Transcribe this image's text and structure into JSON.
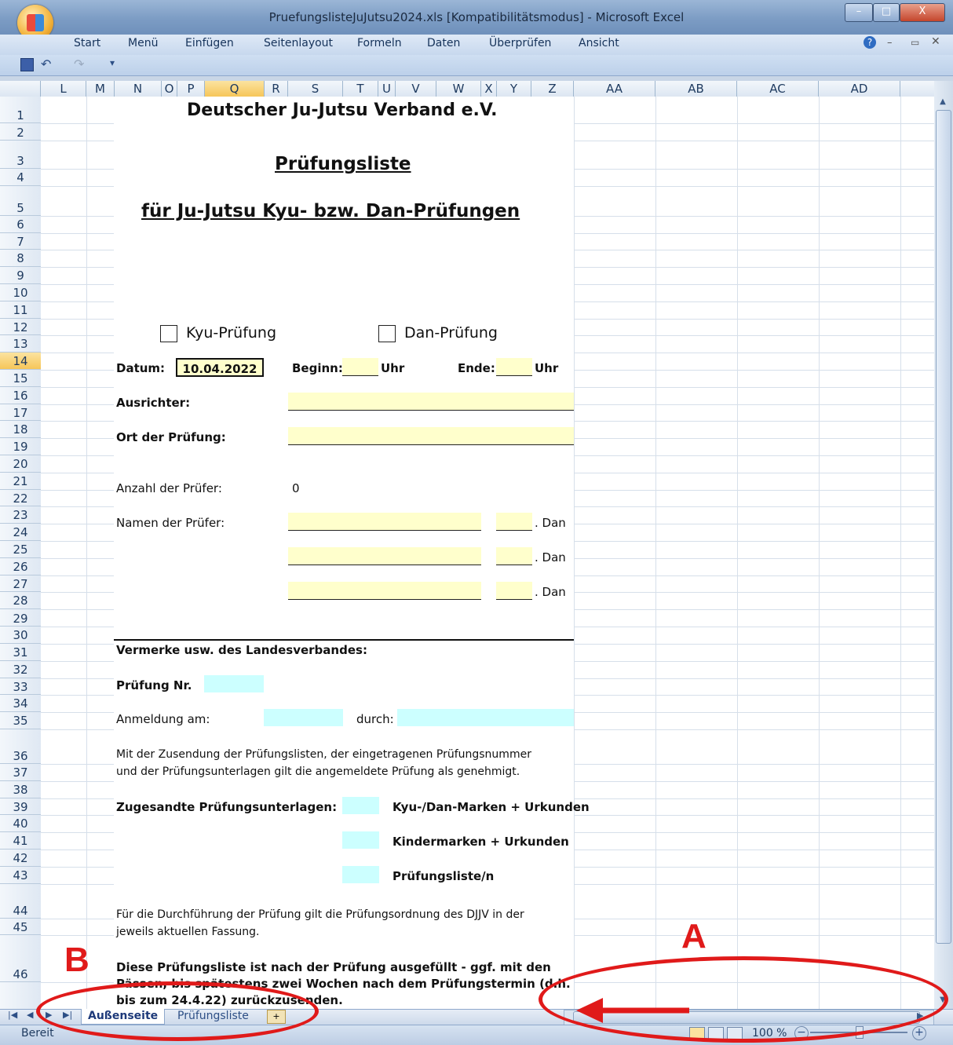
{
  "window": {
    "title": "PruefungslisteJuJutsu2024.xls [Kompatibilitätsmodus] - Microsoft Excel",
    "minimize": "–",
    "maximize": "□",
    "close": "X"
  },
  "ribbon_tabs": [
    "Start",
    "Menü",
    "Einfügen",
    "Seitenlayout",
    "Formeln",
    "Daten",
    "Überprüfen",
    "Ansicht"
  ],
  "quick_access": {
    "save": "save-icon",
    "undo": "undo-icon",
    "redo": "redo-icon",
    "more": "▾"
  },
  "columns": [
    "L",
    "M",
    "N",
    "O",
    "P",
    "Q",
    "R",
    "S",
    "T",
    "U",
    "V",
    "W",
    "X",
    "Y",
    "Z",
    "AA",
    "AB",
    "AC",
    "AD"
  ],
  "selected_column": "Q",
  "rows": [
    "1",
    "2",
    "3",
    "4",
    "5",
    "6",
    "7",
    "8",
    "9",
    "10",
    "11",
    "12",
    "13",
    "14",
    "15",
    "16",
    "17",
    "18",
    "19",
    "20",
    "21",
    "22",
    "23",
    "24",
    "25",
    "26",
    "27",
    "28",
    "29",
    "30",
    "31",
    "32",
    "33",
    "34",
    "35",
    "36",
    "37",
    "38",
    "39",
    "40",
    "41",
    "42",
    "43",
    "44",
    "45",
    "46"
  ],
  "selected_row": "14",
  "sheet": {
    "org": "Deutscher Ju-Jutsu Verband e.V.",
    "heading": "Prüfungsliste",
    "subheading": "für Ju-Jutsu Kyu- bzw. Dan-Prüfungen",
    "kyu_label": "Kyu-Prüfung",
    "dan_label": "Dan-Prüfung",
    "datum_label": "Datum:",
    "datum_value": "10.04.2022",
    "beginn_label": "Beginn:",
    "ende_label": "Ende:",
    "uhr": "Uhr",
    "ausrichter_label": "Ausrichter:",
    "ort_label": "Ort der Prüfung:",
    "anzahl_label": "Anzahl der Prüfer:",
    "anzahl_value": "0",
    "namen_label": "Namen der Prüfer:",
    "dan_suffix": ". Dan",
    "vermerke": "Vermerke usw. des Landesverbandes:",
    "pruefung_nr": "Prüfung Nr.",
    "anmeldung": "Anmeldung am:",
    "durch": "durch:",
    "notice_line1": "Mit der Zusendung der Prüfungslisten, der eingetragenen Prüfungsnummer",
    "notice_line2": "und der Prüfungsunterlagen gilt die angemeldete Prüfung als genehmigt.",
    "zugesandte": "Zugesandte Prüfungsunterlagen:",
    "item1": "Kyu-/Dan-Marken + Urkunden",
    "item2": "Kindermarken + Urkunden",
    "item3": "Prüfungsliste/n",
    "ordnung_line1": "Für die Durchführung der Prüfung gilt die Prüfungsordnung des DJJV in der",
    "ordnung_line2": "jeweils aktuellen Fassung.",
    "final_line1": "Diese Prüfungsliste ist nach der Prüfung ausgefüllt - ggf. mit den",
    "final_line2": "Pässen, bis spätestens zwei Wochen nach dem Prüfungstermin (d.h.",
    "final_line3": "bis zum 24.4.22) zurückzusenden."
  },
  "sheet_tabs": [
    "Außenseite",
    "Prüfungsliste"
  ],
  "active_sheet_tab": "Außenseite",
  "status": {
    "mode": "Bereit",
    "zoom": "100 %"
  },
  "annotations": {
    "a": "A",
    "b": "B",
    "color": "#e01a1a"
  }
}
